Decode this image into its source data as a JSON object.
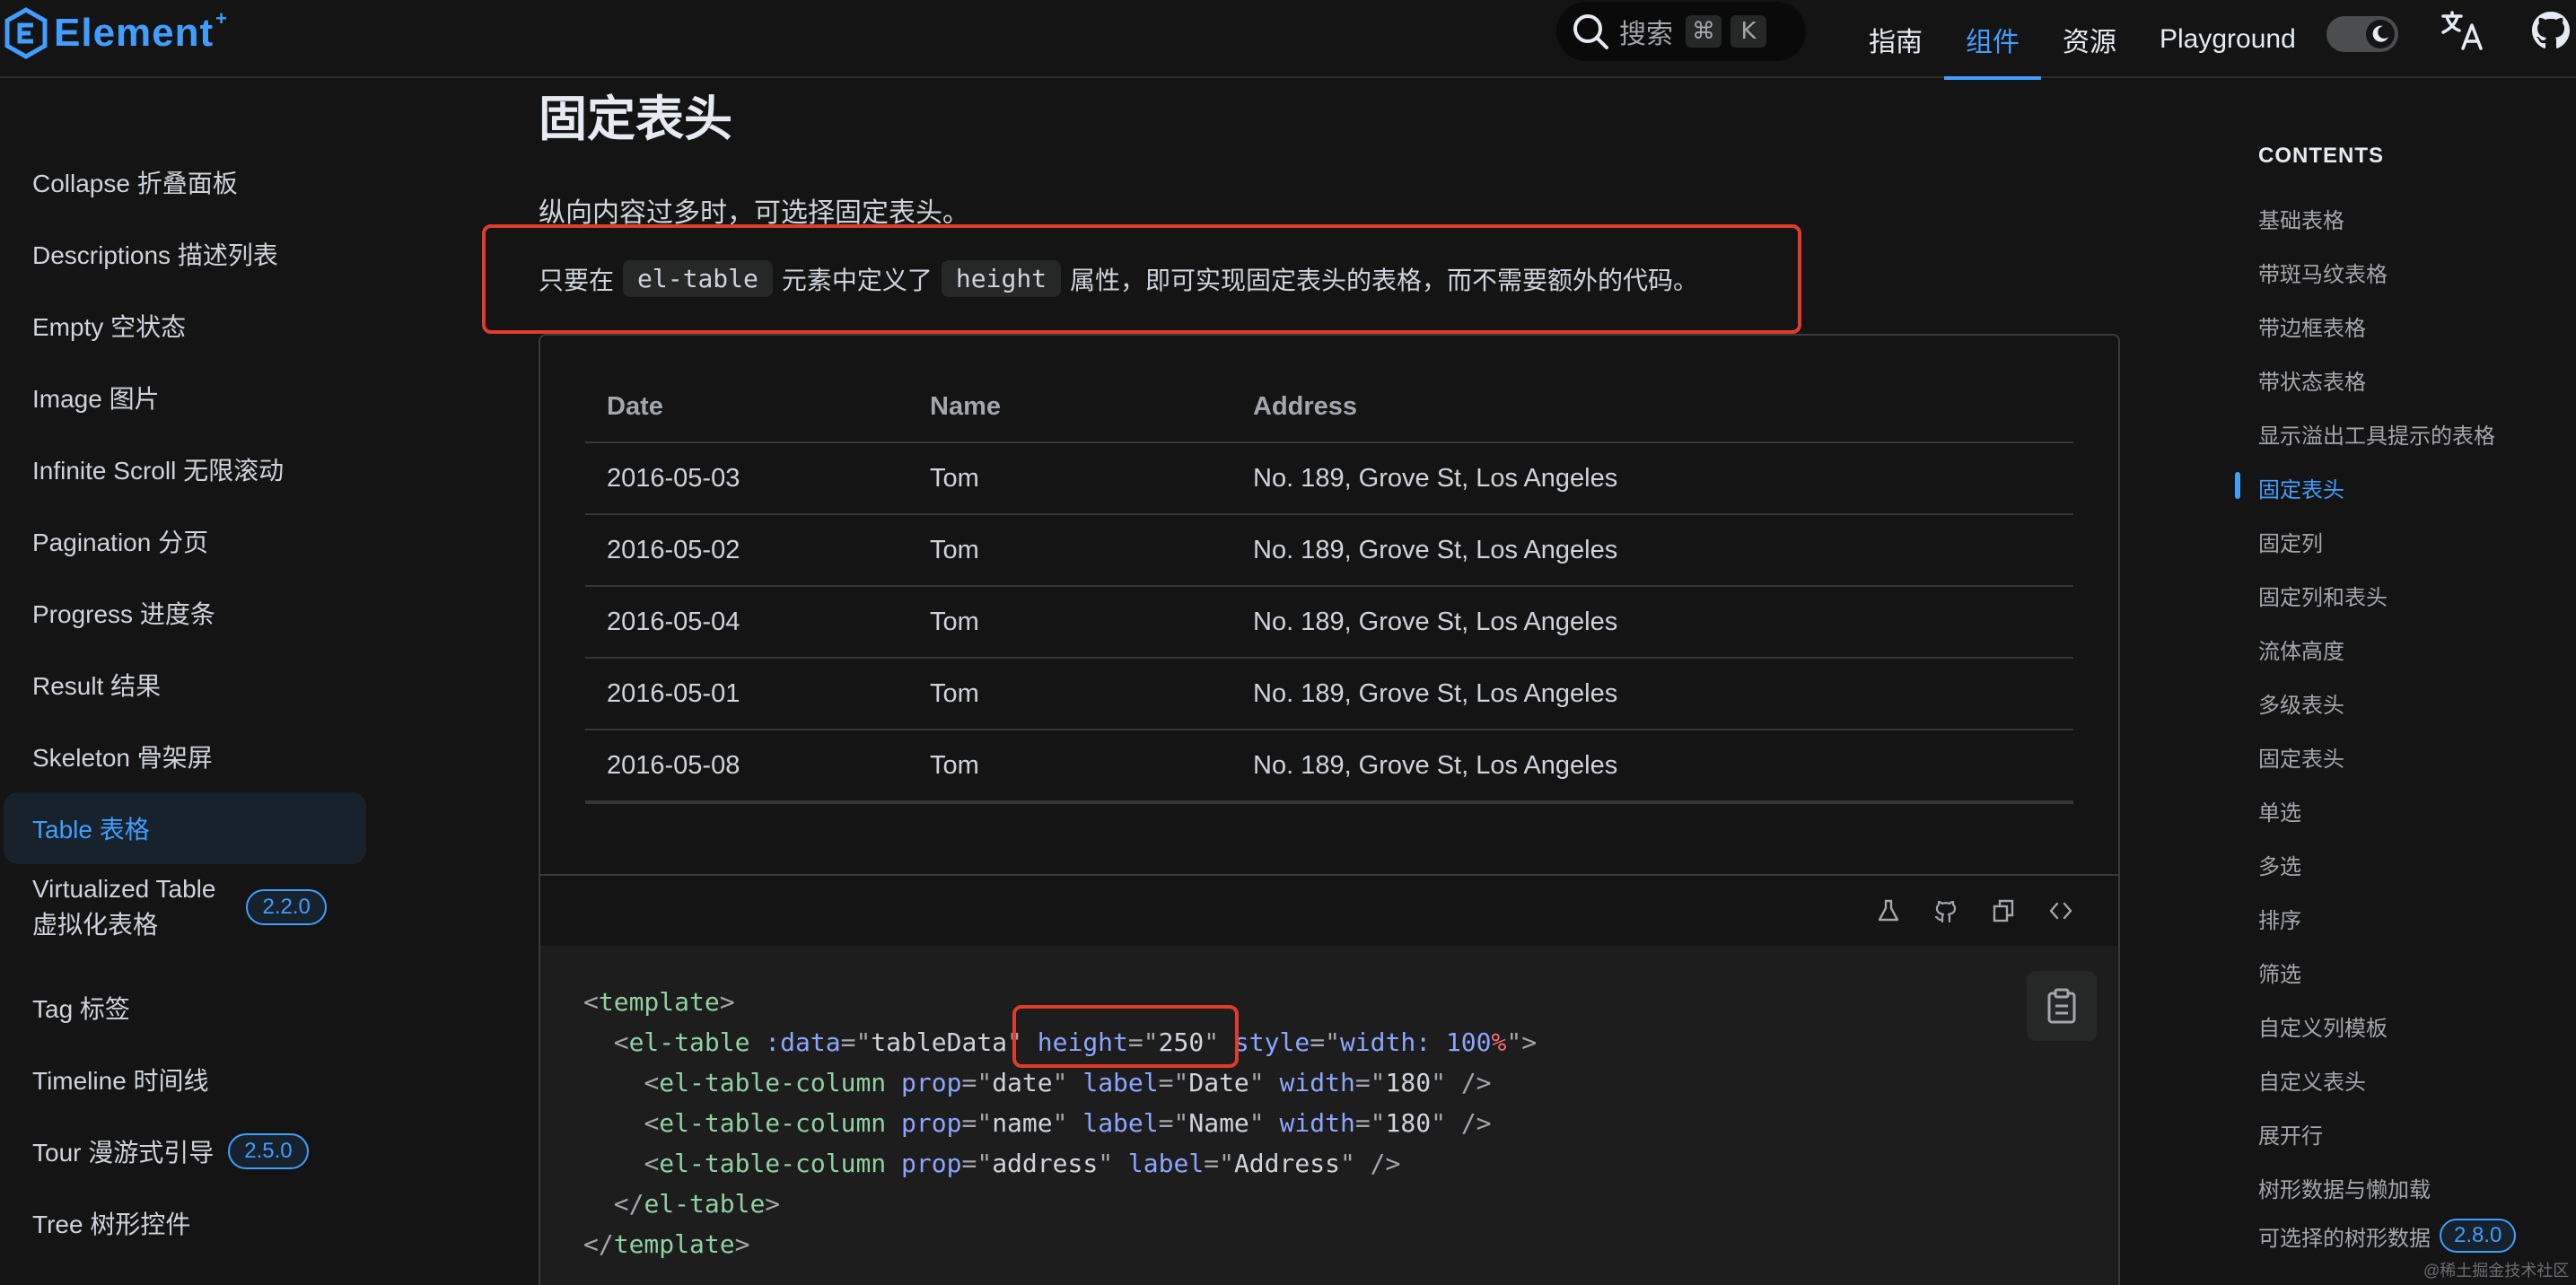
{
  "header": {
    "logo_text": "Element",
    "logo_plus": "+",
    "search_label": "搜索",
    "search_keys": [
      "⌘",
      "K"
    ],
    "nav": [
      "指南",
      "组件",
      "资源",
      "Playground"
    ],
    "active_nav_index": 1,
    "accent_color": "#409eff"
  },
  "sidebar": {
    "items": [
      {
        "label": "Collapse 折叠面板"
      },
      {
        "label": "Descriptions 描述列表"
      },
      {
        "label": "Empty 空状态"
      },
      {
        "label": "Image 图片"
      },
      {
        "label": "Infinite Scroll 无限滚动"
      },
      {
        "label": "Pagination 分页"
      },
      {
        "label": "Progress 进度条"
      },
      {
        "label": "Result 结果"
      },
      {
        "label": "Skeleton 骨架屏"
      },
      {
        "label": "Table 表格"
      },
      {
        "label_line1": "Virtualized Table",
        "label_line2": "虚拟化表格",
        "badge": "2.2.0"
      },
      {
        "label": "Tag 标签"
      },
      {
        "label": "Timeline 时间线"
      },
      {
        "label": "Tour 漫游式引导",
        "badge": "2.5.0"
      },
      {
        "label": "Tree 树形控件"
      }
    ],
    "active_index": 9
  },
  "main": {
    "title": "固定表头",
    "para1": "纵向内容过多时，可选择固定表头。",
    "para2": {
      "before": "只要在",
      "code1": "el-table",
      "middle": "元素中定义了",
      "code2": "height",
      "after": "属性，即可实现固定表头的表格，而不需要额外的代码。"
    },
    "table": {
      "headers": [
        "Date",
        "Name",
        "Address"
      ],
      "rows": [
        [
          "2016-05-03",
          "Tom",
          "No. 189, Grove St, Los Angeles"
        ],
        [
          "2016-05-02",
          "Tom",
          "No. 189, Grove St, Los Angeles"
        ],
        [
          "2016-05-04",
          "Tom",
          "No. 189, Grove St, Los Angeles"
        ],
        [
          "2016-05-01",
          "Tom",
          "No. 189, Grove St, Los Angeles"
        ],
        [
          "2016-05-08",
          "Tom",
          "No. 189, Grove St, Los Angeles"
        ]
      ]
    },
    "toolbar_icons": [
      "playground-icon",
      "github-icon",
      "copy-icon",
      "code-icon"
    ],
    "code": {
      "l1_tag": "template",
      "l2_tag": "el-table",
      "l2_attr1": ":data",
      "l2_val1": "tableData",
      "l2_attr2": "height",
      "l2_val2": "250",
      "l2_attr3": "style",
      "l2_val3_a": "width: ",
      "l2_val3_b": "100",
      "l2_val3_c": "%",
      "col_tag": "el-table-column",
      "prop_attr": "prop",
      "label_attr": "label",
      "width_attr": "width",
      "cols": [
        {
          "prop": "date",
          "label": "Date",
          "width": "180"
        },
        {
          "prop": "name",
          "label": "Name",
          "width": "180"
        },
        {
          "prop": "address",
          "label": "Address"
        }
      ],
      "l6_close": "el-table",
      "l7_close": "template"
    }
  },
  "toc": {
    "title": "CONTENTS",
    "items": [
      {
        "label": "基础表格"
      },
      {
        "label": "带斑马纹表格"
      },
      {
        "label": "带边框表格"
      },
      {
        "label": "带状态表格"
      },
      {
        "label": "显示溢出工具提示的表格"
      },
      {
        "label": "固定表头"
      },
      {
        "label": "固定列"
      },
      {
        "label": "固定列和表头"
      },
      {
        "label": "流体高度"
      },
      {
        "label": "多级表头"
      },
      {
        "label": "固定表头"
      },
      {
        "label": "单选"
      },
      {
        "label": "多选"
      },
      {
        "label": "排序"
      },
      {
        "label": "筛选"
      },
      {
        "label": "自定义列模板"
      },
      {
        "label": "自定义表头"
      },
      {
        "label": "展开行"
      },
      {
        "label": "树形数据与懒加载"
      },
      {
        "label": "可选择的树形数据",
        "badge": "2.8.0"
      }
    ],
    "active_index": 5
  },
  "watermark": "@稀土掘金技术社区"
}
